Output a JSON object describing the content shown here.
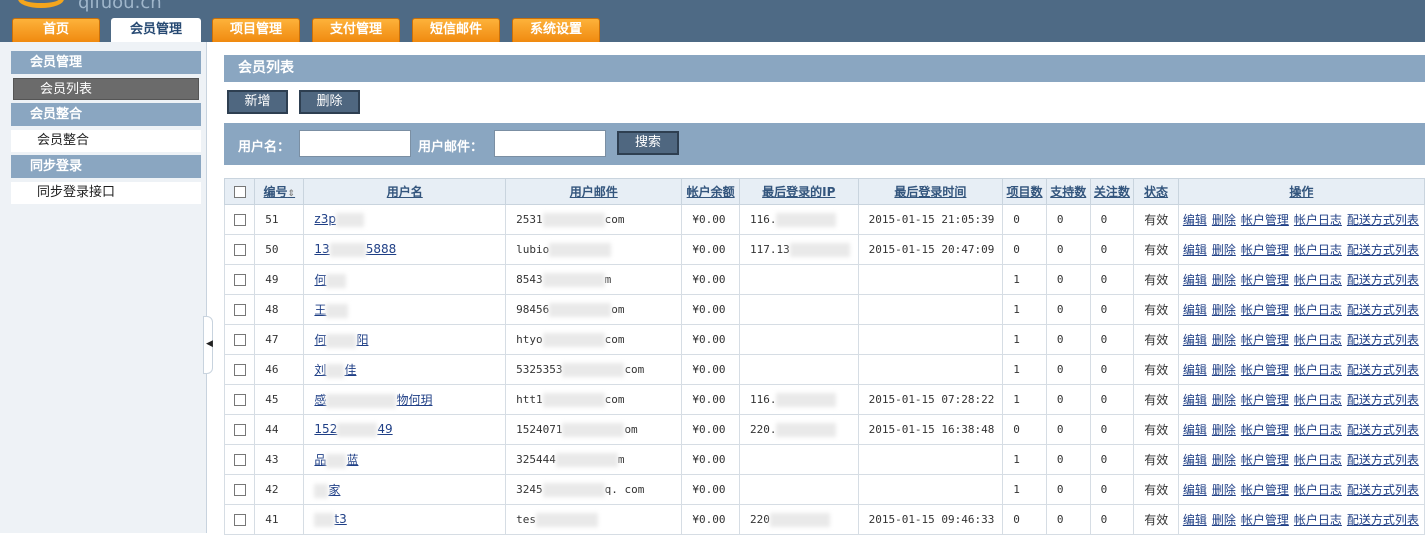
{
  "header": {
    "logo_text": "qifuou.cn",
    "tabs": [
      {
        "label": "首页",
        "active": false
      },
      {
        "label": "会员管理",
        "active": true
      },
      {
        "label": "项目管理",
        "active": false
      },
      {
        "label": "支付管理",
        "active": false
      },
      {
        "label": "短信邮件",
        "active": false
      },
      {
        "label": "系统设置",
        "active": false
      }
    ]
  },
  "sidebar": {
    "groups": [
      {
        "title": "会员管理",
        "items": [
          {
            "label": "会员列表",
            "active": true
          }
        ]
      },
      {
        "title": "会员整合",
        "items": [
          {
            "label": "会员整合",
            "active": false
          }
        ]
      },
      {
        "title": "同步登录",
        "items": [
          {
            "label": "同步登录接口",
            "active": false
          }
        ]
      }
    ]
  },
  "main": {
    "title": "会员列表",
    "buttons": {
      "add": "新增",
      "delete": "删除"
    },
    "search": {
      "username_label": "用户名：",
      "email_label": "用户邮件：",
      "button": "搜索",
      "username_value": "",
      "email_value": ""
    },
    "columns": [
      "编号",
      "用户名",
      "用户邮件",
      "帐户余额",
      "最后登录的IP",
      "最后登录时间",
      "项目数",
      "支持数",
      "关注数",
      "状态",
      "操作"
    ],
    "ops": [
      "编辑",
      "删除",
      "帐户管理",
      "帐户日志",
      "配送方式列表"
    ],
    "rows": [
      {
        "id": "51",
        "name": "z3p",
        "email_a": "2531",
        "email_b": "com",
        "balance": "¥0.00",
        "ip": "116.",
        "time": "2015-01-15 21:05:39",
        "projects": "0",
        "supports": "0",
        "follows": "0",
        "status": "有效"
      },
      {
        "id": "50",
        "name": "13",
        "name_b": "5888",
        "email_a": "lubio",
        "email_b": "",
        "balance": "¥0.00",
        "ip": "117.13",
        "time": "2015-01-15 20:47:09",
        "projects": "0",
        "supports": "0",
        "follows": "0",
        "status": "有效"
      },
      {
        "id": "49",
        "name": "何",
        "email_a": "8543",
        "email_b": "m",
        "balance": "¥0.00",
        "ip": "",
        "time": "",
        "projects": "1",
        "supports": "0",
        "follows": "0",
        "status": "有效"
      },
      {
        "id": "48",
        "name": "王",
        "email_a": "98456",
        "email_b": "om",
        "balance": "¥0.00",
        "ip": "",
        "time": "",
        "projects": "1",
        "supports": "0",
        "follows": "0",
        "status": "有效"
      },
      {
        "id": "47",
        "name": "何",
        "name_b": "阳",
        "email_a": "htyo",
        "email_b": "com",
        "balance": "¥0.00",
        "ip": "",
        "time": "",
        "projects": "1",
        "supports": "0",
        "follows": "0",
        "status": "有效"
      },
      {
        "id": "46",
        "name": "刘",
        "name_b": "佳",
        "email_a": "5325353",
        "email_b": "com",
        "balance": "¥0.00",
        "ip": "",
        "time": "",
        "projects": "1",
        "supports": "0",
        "follows": "0",
        "status": "有效"
      },
      {
        "id": "45",
        "name": "感",
        "name_b": "物何玥",
        "email_a": "htt1",
        "email_b": "com",
        "balance": "¥0.00",
        "ip": "116.",
        "time": "2015-01-15 07:28:22",
        "projects": "1",
        "supports": "0",
        "follows": "0",
        "status": "有效"
      },
      {
        "id": "44",
        "name": "152",
        "name_b": "49",
        "email_a": "1524071",
        "email_b": "om",
        "balance": "¥0.00",
        "ip": "220.",
        "time": "2015-01-15 16:38:48",
        "projects": "0",
        "supports": "0",
        "follows": "0",
        "status": "有效"
      },
      {
        "id": "43",
        "name": "品",
        "name_b": "蓝",
        "email_a": "325444",
        "email_b": "m",
        "balance": "¥0.00",
        "ip": "",
        "time": "",
        "projects": "1",
        "supports": "0",
        "follows": "0",
        "status": "有效"
      },
      {
        "id": "42",
        "name": "",
        "name_b": "家",
        "email_a": "3245",
        "email_b": "q. com",
        "balance": "¥0.00",
        "ip": "",
        "time": "",
        "projects": "1",
        "supports": "0",
        "follows": "0",
        "status": "有效"
      },
      {
        "id": "41",
        "name": "",
        "name_b": "t3",
        "email_a": "tes",
        "email_b": "",
        "balance": "¥0.00",
        "ip": "220",
        "time": "2015-01-15 09:46:33",
        "projects": "0",
        "supports": "0",
        "follows": "0",
        "status": "有效"
      }
    ]
  }
}
